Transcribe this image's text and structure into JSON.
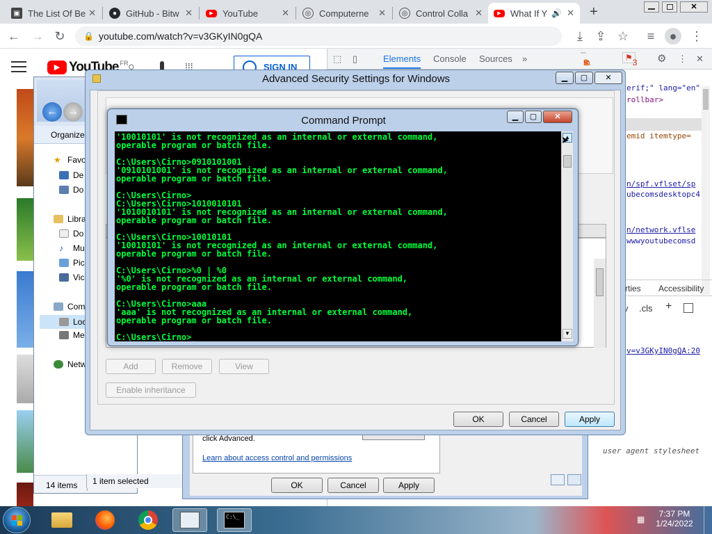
{
  "browser": {
    "tabs": [
      {
        "label": "The List Of Be",
        "icon": "blog-icon"
      },
      {
        "label": "GitHub - Bitw",
        "icon": "github-icon"
      },
      {
        "label": "YouTube",
        "icon": "youtube-icon"
      },
      {
        "label": "Computerne",
        "icon": "computerne-icon"
      },
      {
        "label": "Control Colla",
        "icon": "control-icon"
      },
      {
        "label": "What If Y",
        "icon": "youtube-icon"
      }
    ],
    "new_tab": "+",
    "url": "youtube.com/watch?v=v3GKyIN0gQA"
  },
  "youtube": {
    "logo": "YouTube",
    "region": "FR",
    "sign_in": "SIGN IN"
  },
  "devtools": {
    "tabs": [
      "Elements",
      "Console",
      "Sources",
      "»"
    ],
    "errors": "9",
    "warnings": "3",
    "issues": "3",
    "code_lines": [
      "erif;\" lang=\"en\"",
      "rollbar>",
      "emid itemtype=",
      "n/spf.vflset/sp",
      "ubecomsdesktopc4",
      "n/network.vflse",
      "wwwyoutubecomsd"
    ],
    "styles_tabs": [
      "rties",
      "Accessibility"
    ],
    "filter_tools": [
      ".cls",
      "+"
    ],
    "style_line": "v=v3GKyIN0gQA:20",
    "ua_sheet": "user agent stylesheet"
  },
  "explorer": {
    "organize": "Organize",
    "nav": [
      "Favo",
      "De",
      "Do",
      "Libra",
      "Do",
      "Mu",
      "Pic",
      "Vic",
      "Comp",
      "Loc",
      "Me",
      "Netw"
    ],
    "status_count": "14 items",
    "status_selected": "1 item selected"
  },
  "security_dialog": {
    "title": "Advanced Security Settings for Windows",
    "buttons": {
      "add": "Add",
      "remove": "Remove",
      "view": "View",
      "inheritance": "Enable inheritance",
      "ok": "OK",
      "cancel": "Cancel",
      "apply": "Apply"
    }
  },
  "permissions_dialog": {
    "text": "click Advanced.",
    "link": "Learn about access control and permissions",
    "ok": "OK",
    "cancel": "Cancel",
    "apply": "Apply"
  },
  "cmd": {
    "title": "Command Prompt",
    "lines": [
      "'10010101' is not recognized as an internal or external command,",
      "operable program or batch file.",
      "",
      "C:\\Users\\Cirno>0910101001",
      "'0910101001' is not recognized as an internal or external command,",
      "operable program or batch file.",
      "",
      "C:\\Users\\Cirno>",
      "C:\\Users\\Cirno>1010010101",
      "'1010010101' is not recognized as an internal or external command,",
      "operable program or batch file.",
      "",
      "C:\\Users\\Cirno>10010101",
      "'10010101' is not recognized as an internal or external command,",
      "operable program or batch file.",
      "",
      "C:\\Users\\Cirno>%0 | %0",
      "'%0' is not recognized as an internal or external command,",
      "operable program or batch file.",
      "",
      "C:\\Users\\Cirno>aaa",
      "'aaa' is not recognized as an internal or external command,",
      "operable program or batch file.",
      "",
      "C:\\Users\\Cirno>_"
    ]
  },
  "taskbar": {
    "time": "7:37 PM",
    "date": "1/24/2022",
    "cmd_icon": "C:\\_"
  }
}
